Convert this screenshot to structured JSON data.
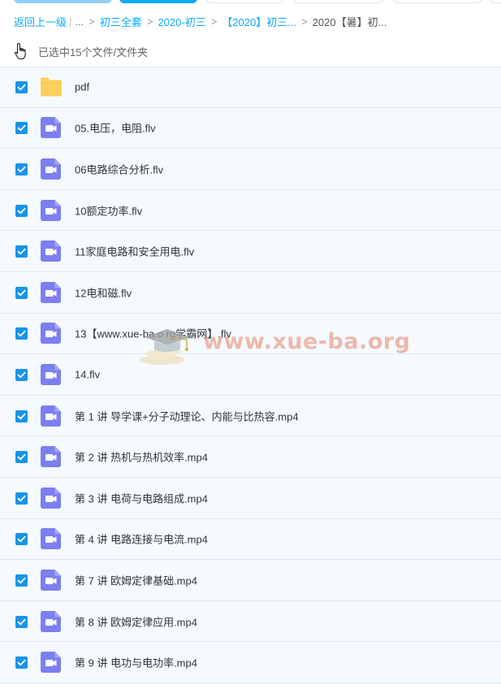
{
  "breadcrumb": {
    "back": "返回上一级",
    "dots": "...",
    "items": [
      "初三全套",
      "2020-初三",
      "【2020】初三...",
      "2020【暑】初..."
    ]
  },
  "selection": {
    "text": "已选中15个文件/文件夹"
  },
  "files": [
    {
      "name": "pdf",
      "type": "folder"
    },
    {
      "name": "05.电压，电阻.flv",
      "type": "video"
    },
    {
      "name": "06电路综合分析.flv",
      "type": "video"
    },
    {
      "name": "10额定功率.flv",
      "type": "video"
    },
    {
      "name": "11家庭电路和安全用电.flv",
      "type": "video"
    },
    {
      "name": "12电和磁.flv",
      "type": "video"
    },
    {
      "name": "13【www.xue-ba.o rg学霸网】.flv",
      "type": "video"
    },
    {
      "name": "14.flv",
      "type": "video"
    },
    {
      "name": "第 1 讲 导学课+分子动理论、内能与比热容.mp4",
      "type": "video"
    },
    {
      "name": "第 2 讲 热机与热机效率.mp4",
      "type": "video"
    },
    {
      "name": "第 3 讲 电荷与电路组成.mp4",
      "type": "video"
    },
    {
      "name": "第 4 讲 电路连接与电流.mp4",
      "type": "video"
    },
    {
      "name": "第 7 讲 欧姆定律基础.mp4",
      "type": "video"
    },
    {
      "name": "第 8 讲 欧姆定律应用.mp4",
      "type": "video"
    },
    {
      "name": "第 9 讲 电功与电功率.mp4",
      "type": "video"
    }
  ],
  "watermark": {
    "text": "www.xue-ba.org"
  },
  "colors": {
    "accent": "#09aaff",
    "checkbox": "#1a93e8",
    "video_icon": "#7b7ff0",
    "folder": "#ffd15c",
    "row_bg": "#f5faff"
  }
}
